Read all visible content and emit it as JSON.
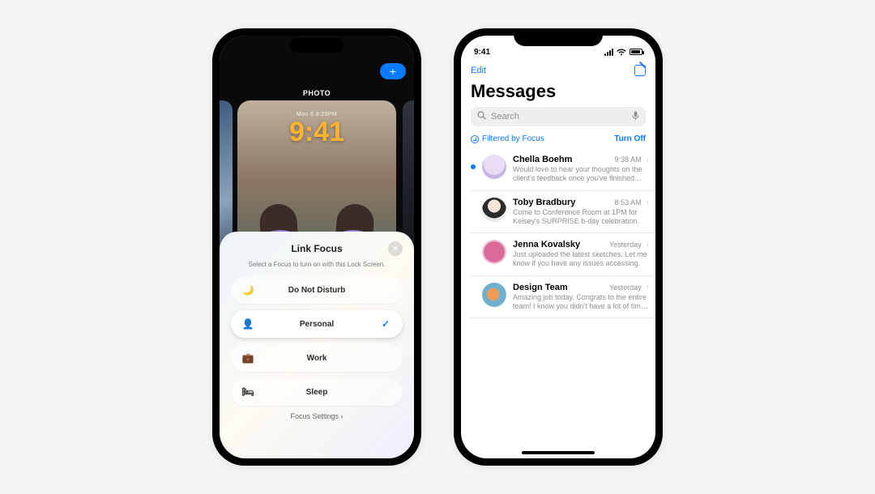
{
  "left_phone": {
    "plus_label": "+",
    "gallery_label": "PHOTO",
    "wallpaper_meta": "Mon 6  8:29PM",
    "wallpaper_clock": "9:41",
    "sheet": {
      "title": "Link Focus",
      "subtitle": "Select a Focus to turn on with this Lock Screen.",
      "footer": "Focus Settings  ›",
      "options": [
        {
          "id": "dnd",
          "label": "Do Not Disturb",
          "icon": "🌙",
          "selected": false
        },
        {
          "id": "personal",
          "label": "Personal",
          "icon": "👤",
          "selected": true
        },
        {
          "id": "work",
          "label": "Work",
          "icon": "💼",
          "selected": false
        },
        {
          "id": "sleep",
          "label": "Sleep",
          "icon": "🛏",
          "selected": false
        }
      ]
    }
  },
  "right_phone": {
    "status_time": "9:41",
    "edit": "Edit",
    "title": "Messages",
    "search_placeholder": "Search",
    "filter_label": "Filtered by Focus",
    "turn_off": "Turn Off",
    "threads": [
      {
        "unread": true,
        "name": "Chella Boehm",
        "time": "9:38 AM",
        "preview": "Would love to hear your thoughts on the client's feedback once you've finished th…"
      },
      {
        "unread": false,
        "name": "Toby Bradbury",
        "time": "8:53 AM",
        "preview": "Come to Conference Room at 1PM for Kelsey's SURPRISE b-day celebration."
      },
      {
        "unread": false,
        "name": "Jenna Kovalsky",
        "time": "Yesterday",
        "preview": "Just uploaded the latest sketches. Let me know if you have any issues accessing."
      },
      {
        "unread": false,
        "name": "Design Team",
        "time": "Yesterday",
        "preview": "Amazing job today. Congrats to the entire team! I know you didn't have a lot of tim…"
      }
    ]
  }
}
